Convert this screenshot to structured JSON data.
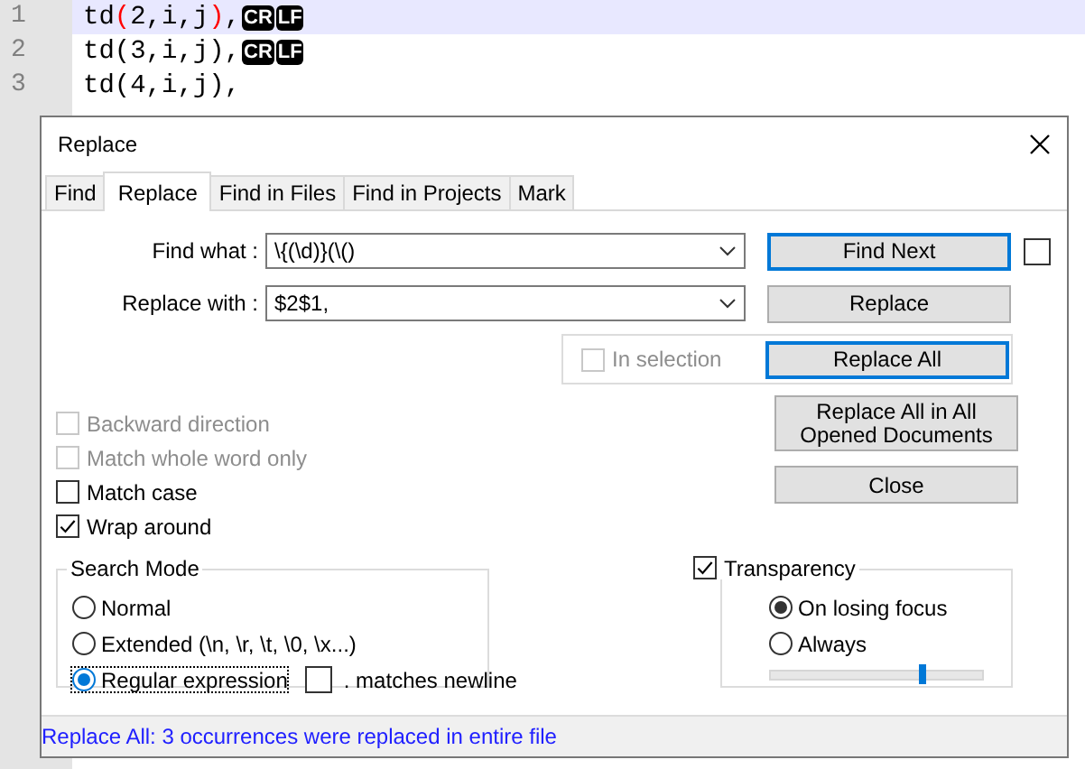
{
  "editor": {
    "lines": [
      {
        "number": "1",
        "current": true,
        "segments": [
          {
            "text": "td",
            "kind": "plain"
          },
          {
            "text": "(",
            "kind": "brace"
          },
          {
            "text": "2,i,j",
            "kind": "plain"
          },
          {
            "text": ")",
            "kind": "brace"
          },
          {
            "text": ",",
            "kind": "plain"
          }
        ],
        "eol": [
          "CR",
          "LF"
        ]
      },
      {
        "number": "2",
        "current": false,
        "segments": [
          {
            "text": "td(3,i,j),",
            "kind": "plain"
          }
        ],
        "eol": [
          "CR",
          "LF"
        ]
      },
      {
        "number": "3",
        "current": false,
        "segments": [
          {
            "text": "td(4,i,j),",
            "kind": "plain"
          }
        ]
      }
    ]
  },
  "dialog": {
    "title": "Replace",
    "tabs": [
      {
        "label": "Find",
        "selected": false
      },
      {
        "label": "Replace",
        "selected": true
      },
      {
        "label": "Find in Files",
        "selected": false
      },
      {
        "label": "Find in Projects",
        "selected": false
      },
      {
        "label": "Mark",
        "selected": false
      }
    ],
    "find_what": {
      "label": "Find what :",
      "value": "\\{(\\d)}(\\()"
    },
    "replace_with": {
      "label": "Replace with :",
      "value": "$2$1,"
    },
    "find_next": {
      "label": "Find Next",
      "focused": true
    },
    "find_next_checkbox": {
      "checked": false
    },
    "replace": {
      "label": "Replace",
      "focused": false
    },
    "in_selection": {
      "label": "In selection",
      "checked": false,
      "disabled": true
    },
    "replace_all": {
      "label": "Replace All",
      "focused": true
    },
    "replace_all_opened": {
      "label": "Replace All in All Opened Documents",
      "focused": false
    },
    "close": {
      "label": "Close",
      "focused": false
    },
    "options": [
      {
        "label": "Backward direction",
        "checked": false,
        "disabled": true
      },
      {
        "label": "Match whole word only",
        "checked": false,
        "disabled": true
      },
      {
        "label": "Match case",
        "checked": false,
        "disabled": false
      },
      {
        "label": "Wrap around",
        "checked": true,
        "disabled": false
      }
    ],
    "search_mode": {
      "title": "Search Mode",
      "modes": [
        {
          "label": "Normal",
          "selected": false
        },
        {
          "label": "Extended (\\n, \\r, \\t, \\0, \\x...)",
          "selected": false
        },
        {
          "label": "Regular expression",
          "selected": true
        }
      ],
      "matches_newline": {
        "label": ". matches newline",
        "checked": false
      }
    },
    "transparency": {
      "label": "Transparency",
      "checked": true,
      "modes": [
        {
          "label": "On losing focus",
          "selected": true
        },
        {
          "label": "Always",
          "selected": false
        }
      ],
      "level": 0.72
    },
    "status": "Replace All: 3 occurrences were replaced in entire file"
  }
}
